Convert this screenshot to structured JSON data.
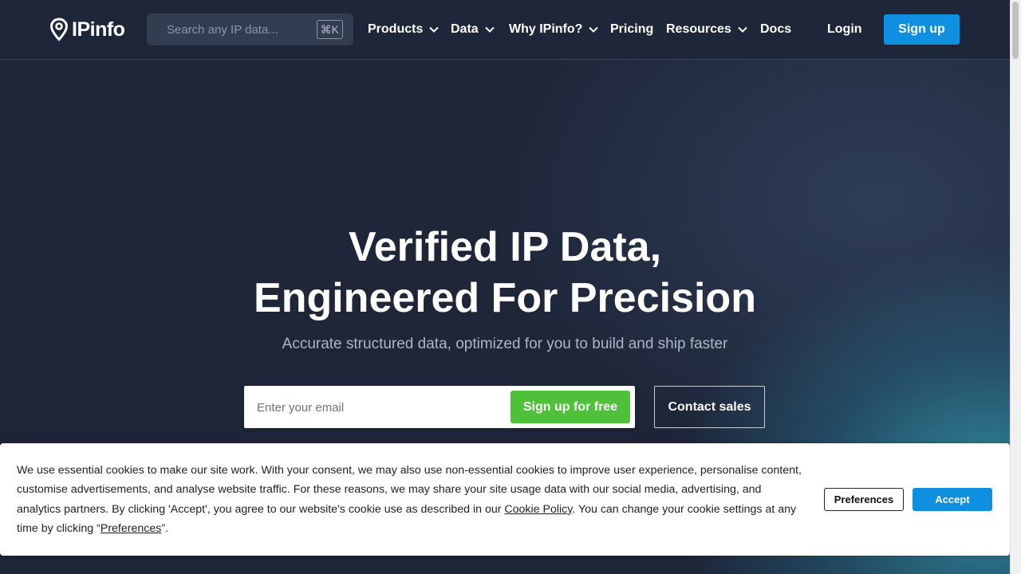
{
  "header": {
    "logo_text": "IPinfo",
    "search": {
      "placeholder": "Search any IP data...",
      "shortcut": "⌘K"
    },
    "nav": [
      {
        "label": "Products",
        "dropdown": true
      },
      {
        "label": "Data",
        "dropdown": true
      },
      {
        "label": "Why IPinfo?",
        "dropdown": true
      },
      {
        "label": "Pricing",
        "dropdown": false
      },
      {
        "label": "Resources",
        "dropdown": true
      },
      {
        "label": "Docs",
        "dropdown": false
      }
    ],
    "login_label": "Login",
    "signup_label": "Sign up"
  },
  "hero": {
    "title_line1": "Verified IP Data,",
    "title_line2": "Engineered For Precision",
    "subtitle": "Accurate structured data, optimized for you to build and ship faster",
    "email_placeholder": "Enter your email",
    "cta_primary": "Sign up for free",
    "cta_secondary": "Contact sales"
  },
  "cookie_banner": {
    "text_before_policy": "We use essential cookies to make our site work. With your consent, we may also use non-essential cookies to improve user experience, personalise content, customise advertisements, and analyse website traffic. For these reasons, we may share your site usage data with our social media, advertising, and analytics partners. By clicking 'Accept', you agree to our website's cookie use as described in our ",
    "policy_link": "Cookie Policy",
    "text_after_policy": ". You can change your cookie settings at any time by clicking “",
    "preferences_link": "Preferences",
    "text_end": "”.",
    "preferences_button": "Preferences",
    "accept_button": "Accept"
  },
  "colors": {
    "background": "#1e2639",
    "primary_blue": "#0f8fe0",
    "cta_green": "#4fc03a",
    "search_bg": "#333d52"
  }
}
